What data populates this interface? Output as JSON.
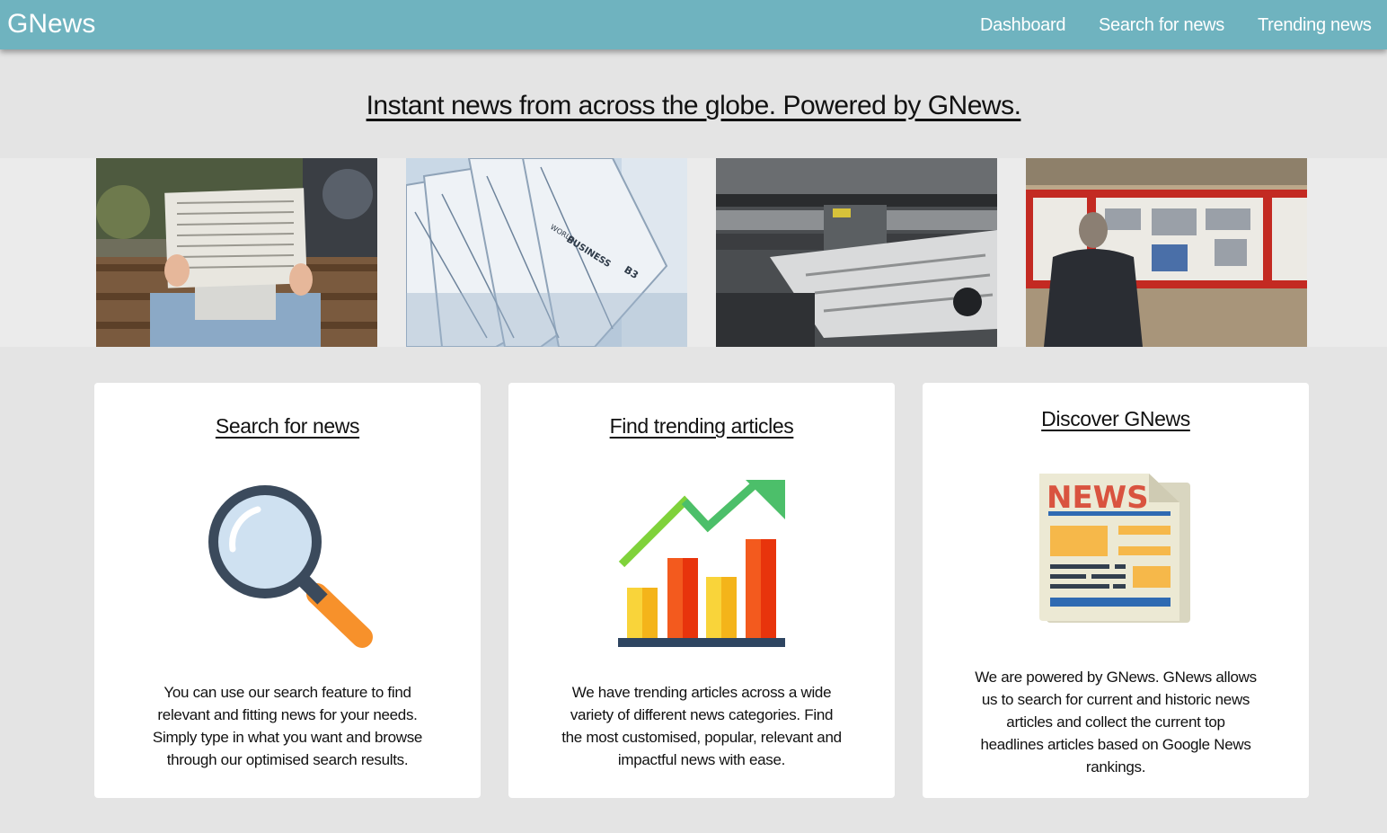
{
  "navbar": {
    "brand": "GNews",
    "links": [
      "Dashboard",
      "Search for news",
      "Trending news"
    ]
  },
  "hero": {
    "headline": "Instant news from across the globe. Powered by GNews."
  },
  "photos": [
    {
      "name": "person-reading-newspaper-photo"
    },
    {
      "name": "stacked-newspapers-photo",
      "visible_text": [
        "BUSINESS",
        "WORLD",
        "B3"
      ]
    },
    {
      "name": "printing-press-photo"
    },
    {
      "name": "man-reading-posted-newspapers-photo"
    }
  ],
  "cards": [
    {
      "title": "Search for news",
      "icon": "magnifying-glass-icon",
      "lines": [
        "You can use our search feature to find",
        "relevant and fitting news for your needs.",
        "Simply type in what you want and browse",
        "through our optimised search results."
      ]
    },
    {
      "title": "Find trending articles",
      "icon": "trending-chart-icon",
      "lines": [
        "We have trending articles across a wide",
        "variety of different news categories. Find",
        "the most customised, popular, relevant and",
        "impactful news with ease."
      ]
    },
    {
      "title": "Discover GNews",
      "icon": "newspaper-icon",
      "icon_text": "NEWS",
      "lines": [
        "We are powered by GNews. GNews allows",
        "us to search for current and historic news",
        "articles and collect the current top",
        "headlines articles based on Google News",
        "rankings."
      ]
    }
  ],
  "colors": {
    "navbar": "#6fb3bf",
    "page_background": "#e4e4e4",
    "card_background": "#ffffff"
  }
}
